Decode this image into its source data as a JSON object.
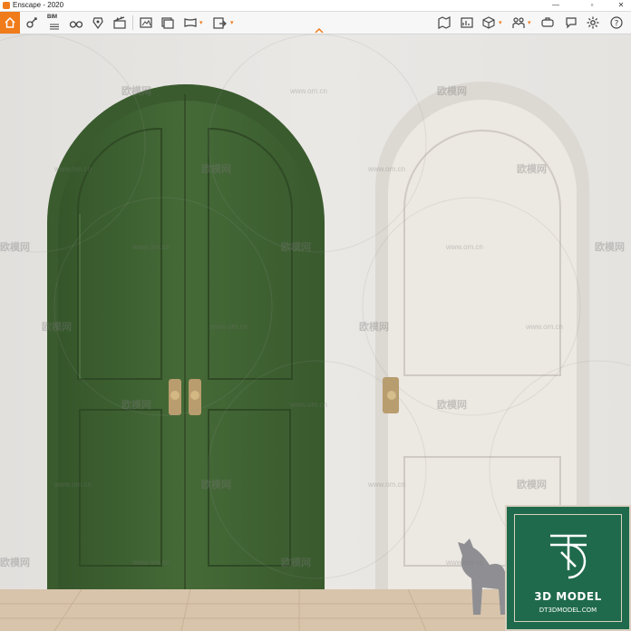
{
  "window": {
    "title": "Enscape - 2020",
    "minimize": "—",
    "maximize": "▫",
    "close": "✕"
  },
  "toolbar": {
    "home_tooltip": "",
    "bim_label": "BIM",
    "collapse_glyph": "^"
  },
  "watermarks": {
    "brand": "欧模网",
    "url": "www.om.cn"
  },
  "logo": {
    "title": "3D MODEL",
    "subtitle": "DT3DMODEL.COM"
  },
  "colors": {
    "accent": "#f07b1a",
    "green_door": "#3f6232",
    "white_door": "#ece8e2",
    "wall": "#e6e4e1",
    "floor": "#d9c6ad",
    "logo_bg": "#1f6a4c"
  }
}
